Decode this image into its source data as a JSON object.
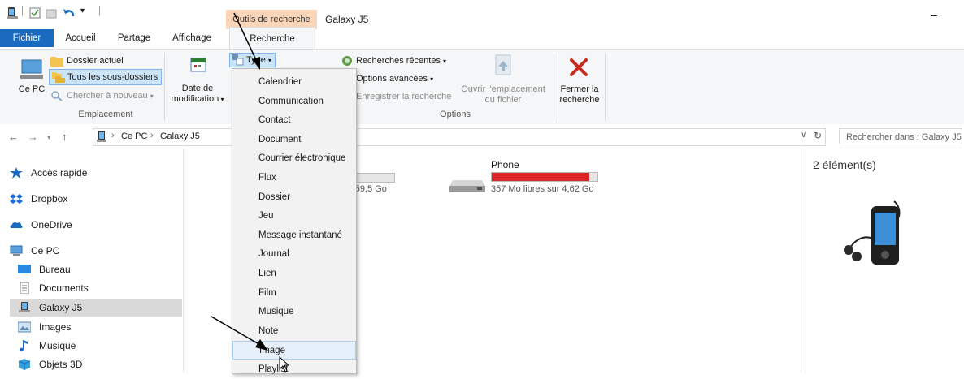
{
  "titlebar": {
    "context_tab": "Outils de recherche",
    "window_title": "Galaxy J5",
    "minimize_glyph": "–"
  },
  "tabs": {
    "fichier": "Fichier",
    "accueil": "Accueil",
    "partage": "Partage",
    "affichage": "Affichage",
    "recherche": "Recherche"
  },
  "ribbon": {
    "emplacement": {
      "label": "Emplacement",
      "ce_pc": "Ce PC",
      "dossier_actuel": "Dossier actuel",
      "tous_sous_dossiers": "Tous les sous-dossiers",
      "chercher_nouveau": "Chercher à nouveau"
    },
    "affiner": {
      "date_modification_1": "Date de",
      "date_modification_2": "modification",
      "type": "Type"
    },
    "options": {
      "label": "Options",
      "recherches_recentes": "Recherches récentes",
      "options_avancees": "Options avancées",
      "enregistrer": "Enregistrer la recherche",
      "ouvrir_emplacement_1": "Ouvrir l'emplacement",
      "ouvrir_emplacement_2": "du fichier",
      "fermer_1": "Fermer la",
      "fermer_2": "recherche"
    }
  },
  "address": {
    "crumb1": "Ce PC",
    "crumb2": "Galaxy J5",
    "search_placeholder": "Rechercher dans : Galaxy J5"
  },
  "nav_pane": {
    "items": [
      "Accès rapide",
      "Dropbox",
      "OneDrive",
      "Ce PC",
      "Bureau",
      "Documents",
      "Galaxy J5",
      "Images",
      "Musique",
      "Objets 3D"
    ]
  },
  "drives": [
    {
      "name": "",
      "free_text": "r 59,5 Go",
      "used_fraction": 0.0
    },
    {
      "name": "Phone",
      "free_text": "357 Mo libres sur 4,62 Go",
      "used_fraction": 0.92
    }
  ],
  "details": {
    "count": "2 élément(s)"
  },
  "type_menu": {
    "items": [
      "Calendrier",
      "Communication",
      "Contact",
      "Document",
      "Courrier électronique",
      "Flux",
      "Dossier",
      "Jeu",
      "Message instantané",
      "Journal",
      "Lien",
      "Film",
      "Musique",
      "Note",
      "Image",
      "Playlist"
    ],
    "highlighted": "Image"
  },
  "colors": {
    "accent_blue": "#1a6bbf",
    "context_tab": "#fad5b8",
    "drive_bar_red": "#da2626",
    "close_red": "#c42b1c"
  }
}
